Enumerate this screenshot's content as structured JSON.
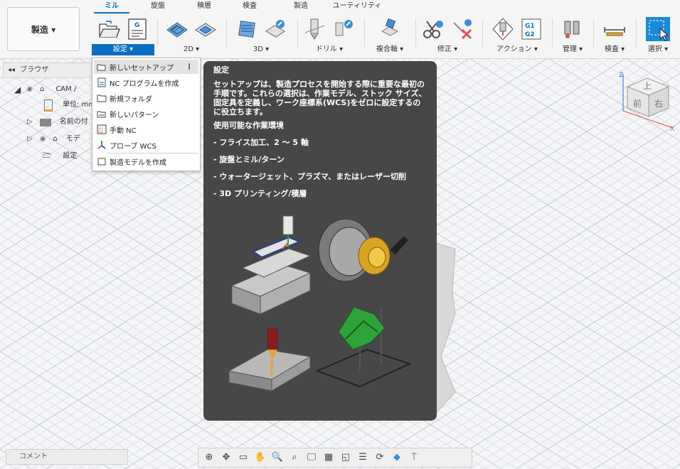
{
  "workspace": {
    "label": "製造 ▾"
  },
  "tabs": [
    "ミル",
    "旋盤",
    "積層",
    "検査",
    "製造",
    "ユーティリティ"
  ],
  "groups": [
    {
      "label": "設定 ▾",
      "selected": true
    },
    {
      "label": "2D ▾"
    },
    {
      "label": "3D ▾"
    },
    {
      "label": "ドリル ▾"
    },
    {
      "label": "複合軸 ▾"
    },
    {
      "label": "修正 ▾"
    },
    {
      "label": "アクション ▾"
    },
    {
      "label": "管理 ▾"
    },
    {
      "label": "検査 ▾"
    },
    {
      "label": "選択 ▾"
    }
  ],
  "setup_icon_text": "G",
  "action_icon_text": "G1\nG2",
  "browser": {
    "title": "ブラウザ",
    "rows": [
      "CAM /",
      "単位: mm",
      "名前の付",
      "モデ",
      "設定"
    ]
  },
  "menu": {
    "items": [
      "新しいセットアップ",
      "NC プログラムを作成",
      "新規フォルダ",
      "新しいパターン",
      "手動 NC",
      "プローブ WCS",
      "製造モデルを作成"
    ],
    "more": "⋮"
  },
  "tooltip": {
    "title": "設定",
    "description": "セットアップは、製造プロセスを開始する際に重要な最初の手順です。これらの選択は、作業モデル、ストック サイズ、固定具を定義し、ワーク座標系(WCS)をゼロに設定するのに役立ちます。",
    "env_heading": "使用可能な作業環境",
    "env_items": [
      "- フライス加工、2 〜 5 軸",
      "- 旋盤とミル/ターン",
      "- ウォータージェット、プラズマ、またはレーザー切削",
      "- 3D プリンティング/積層"
    ]
  },
  "viewcube": {
    "top": "上",
    "front": "前",
    "right": "右",
    "axis_z": "Z",
    "axis_x": "X"
  },
  "comment": {
    "label": "コメント"
  },
  "colors": {
    "accent": "#0a6fc2",
    "tooltip_bg": "#474747"
  }
}
